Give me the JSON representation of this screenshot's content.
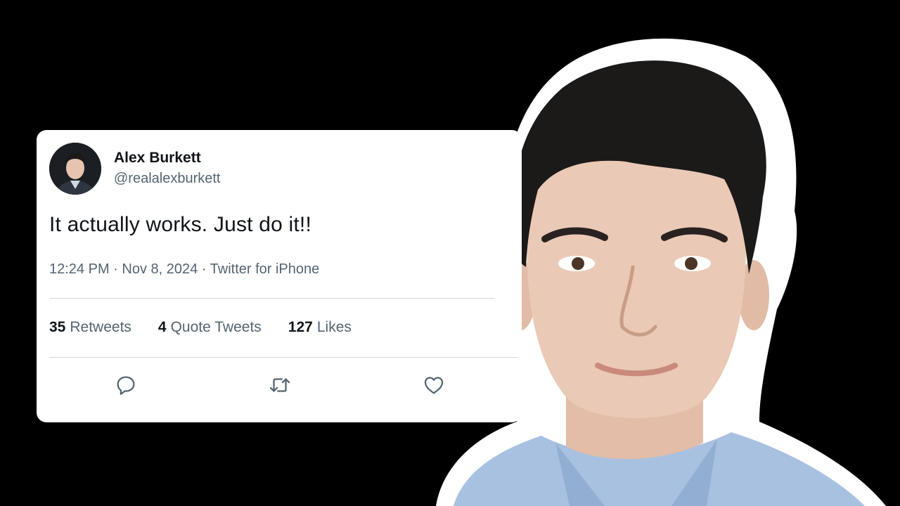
{
  "tweet": {
    "display_name": "Alex Burkett",
    "handle": "@realalexburkett",
    "text": "It actually works. Just do it!!",
    "meta": "12:24 PM · Nov 8, 2024 · Twitter for iPhone",
    "stats": [
      {
        "count": "35",
        "label": "Retweets"
      },
      {
        "count": "4",
        "label": "Quote Tweets"
      },
      {
        "count": "127",
        "label": "Likes"
      }
    ],
    "actions": {
      "reply_icon": "reply-icon",
      "retweet_icon": "retweet-icon",
      "like_icon": "heart-icon"
    }
  },
  "colors": {
    "background": "#000000",
    "card": "#ffffff",
    "primary_text": "#0f1419",
    "secondary_text": "#536471",
    "divider": "#d5dade",
    "shirt": "#a9c1e0",
    "hair": "#1c1a19",
    "skin": "#eac9b6"
  }
}
